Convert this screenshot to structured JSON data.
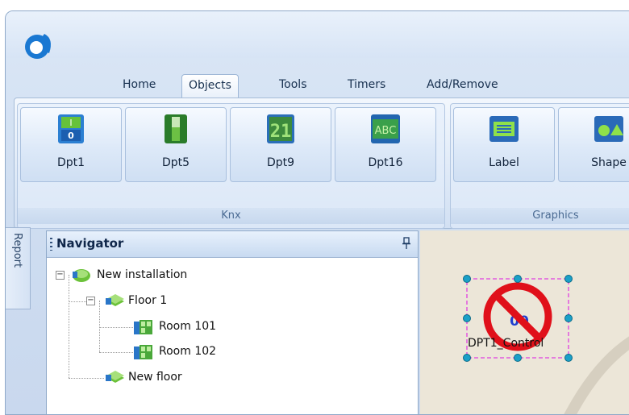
{
  "ribbon": {
    "tabs": [
      {
        "label": "Home"
      },
      {
        "label": "Objects"
      },
      {
        "label": "Tools"
      },
      {
        "label": "Timers"
      },
      {
        "label": "Add/Remove"
      }
    ],
    "active_tab": "Objects",
    "groups": {
      "knx": {
        "label": "Knx",
        "buttons": [
          {
            "label": "Dpt1",
            "icon": "dpt1-switch-icon"
          },
          {
            "label": "Dpt5",
            "icon": "dpt5-slider-icon"
          },
          {
            "label": "Dpt9",
            "icon": "dpt9-numeric-icon"
          },
          {
            "label": "Dpt16",
            "icon": "dpt16-text-icon"
          }
        ]
      },
      "graphics": {
        "label": "Graphics",
        "buttons": [
          {
            "label": "Label",
            "icon": "label-icon"
          },
          {
            "label": "Shape",
            "icon": "shape-icon"
          }
        ]
      }
    },
    "icon_glyphs": {
      "dpt1": {
        "top": "I",
        "bottom": "0"
      },
      "dpt9": "21",
      "dpt16": "ABC"
    }
  },
  "sidebar": {
    "report_tab": "Report"
  },
  "navigator": {
    "title": "Navigator",
    "tree": {
      "root": "New installation",
      "floor1": "Floor 1",
      "room101": "Room 101",
      "room102": "Room 102",
      "new_floor": "New floor"
    },
    "expander_glyph": "−"
  },
  "canvas": {
    "control": {
      "value": "00",
      "name": "DPT1_Control"
    }
  },
  "colors": {
    "accent": "#1f7fd6",
    "selection": "#e040e0",
    "handle": "#1aa0c8",
    "prohibit": "#e0101a"
  }
}
